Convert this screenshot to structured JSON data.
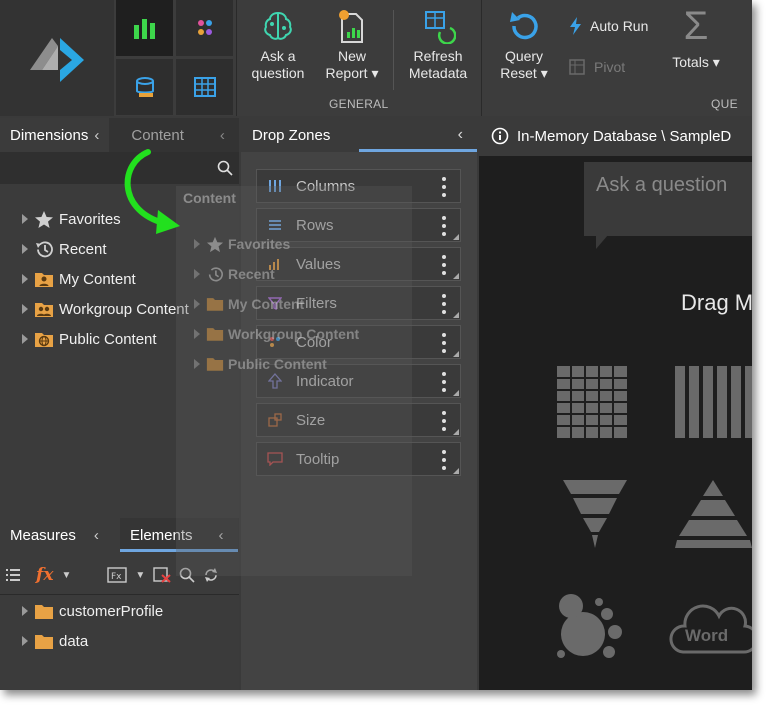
{
  "ribbon": {
    "general": {
      "group_label": "GENERAL",
      "ask": "Ask a\nquestion",
      "ask_l1": "Ask a",
      "ask_l2": "question",
      "new_l1": "New",
      "new_l2": "Report ▾",
      "refresh_l1": "Refresh",
      "refresh_l2": "Metadata"
    },
    "query": {
      "group_label": "QUE",
      "reset_l1": "Query",
      "reset_l2": "Reset ▾",
      "auto_run": "Auto Run",
      "pivot": "Pivot",
      "totals": "Totals ▾"
    }
  },
  "left_panel": {
    "tabs": {
      "dimensions": "Dimensions",
      "content": "Content"
    },
    "tree": [
      {
        "label": "Favorites",
        "icon": "star-icon"
      },
      {
        "label": "Recent",
        "icon": "history-icon"
      },
      {
        "label": "My Content",
        "icon": "user-folder-icon"
      },
      {
        "label": "Workgroup Content",
        "icon": "group-folder-icon"
      },
      {
        "label": "Public Content",
        "icon": "globe-folder-icon"
      }
    ],
    "ghost": {
      "title": "Content",
      "items": [
        "Favorites",
        "Recent",
        "My Content",
        "Workgroup Content",
        "Public Content"
      ]
    },
    "bottom_tabs": {
      "measures": "Measures",
      "elements": "Elements"
    },
    "bottom_tree": [
      {
        "label": "customerProfile"
      },
      {
        "label": "data"
      }
    ]
  },
  "drop_zones": {
    "title": "Drop Zones",
    "zones": [
      "Columns",
      "Rows",
      "Values",
      "Filters",
      "Color",
      "Indicator",
      "Size",
      "Tooltip"
    ]
  },
  "canvas": {
    "breadcrumb": "In-Memory Database \\ SampleD",
    "ask_placeholder": "Ask a question",
    "drag_text": "Drag M",
    "wordcloud_label": "Word"
  },
  "colors": {
    "accent": "#6fa6e0",
    "green_arrow": "#22e01e",
    "folder": "#e8a245",
    "chart_icon": "#6a6a6a"
  }
}
